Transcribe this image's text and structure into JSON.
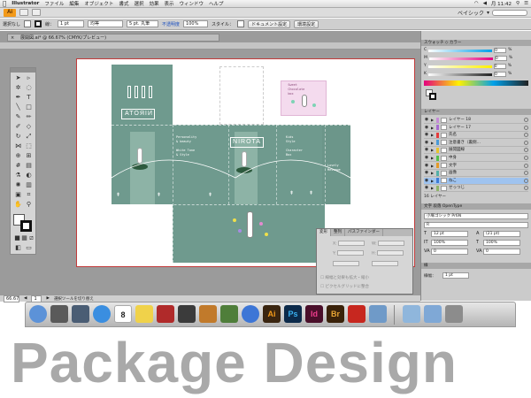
{
  "menubar": {
    "app_name": "Illustrator",
    "items": [
      "ファイル",
      "編集",
      "オブジェクト",
      "書式",
      "選択",
      "効果",
      "表示",
      "ウィンドウ",
      "ヘルプ"
    ],
    "clock": "月 11:42"
  },
  "appbar": {
    "logo": "Ai",
    "workspace": "ベイシック"
  },
  "controlbar": {
    "selection": "選択なし",
    "stroke_weight": "1 pt",
    "stroke_style": "均等",
    "brush": "5 pt. 丸筆",
    "opacity_label": "不透明度",
    "opacity_value": "100%",
    "style_label": "スタイル：",
    "doc_setup_button": "ドキュメント設定",
    "preferences_button": "環境設定"
  },
  "document": {
    "tab_title": "展開図.ai* @ 66.67% (CMYK/プレビュー)"
  },
  "artboard": {
    "brand": "NIROTA",
    "brand_mirrored": "NIROTA",
    "label_text": "   Sweet\n   Chocolate\n   box",
    "info_block": "Personality\n& beauty\n\nWhite Tone\n& Style",
    "right_block": "Kids\nStyle\n\nCharacter\nBox",
    "side_block": "Lovely\nMessage"
  },
  "transform_panel": {
    "tabs": [
      "変形",
      "整列",
      "パスファインダー"
    ],
    "x_label": "X:",
    "y_label": "Y:",
    "w_label": "W:",
    "h_label": "H:",
    "x_value": "0 mm",
    "y_value": "0 mm",
    "w_value": "0 mm",
    "h_value": "0 mm",
    "angle_value": "0°",
    "shear_value": "0°",
    "opt_scale": "線幅と効果も拡大・縮小",
    "opt_grid": "ピクセルグリッドに整合"
  },
  "statusbar": {
    "zoom": "66.67",
    "page": "1",
    "tool_hint": "選択ツールを切り替え"
  },
  "panels": {
    "swatch_tab": "スウォッチ",
    "color_tab": "カラー",
    "color_rows": [
      {
        "label": "C",
        "value": "0",
        "unit": "%",
        "color": "#00a0e9"
      },
      {
        "label": "M",
        "value": "0",
        "unit": "%",
        "color": "#e4007f"
      },
      {
        "label": "Y",
        "value": "0",
        "unit": "%",
        "color": "#fff100"
      },
      {
        "label": "K",
        "value": "0",
        "unit": "%",
        "color": "#222222"
      }
    ],
    "layers_tab": "レイヤー",
    "layers": [
      {
        "name": "レイヤー 18",
        "color": "#c58bd6"
      },
      {
        "name": "レイヤー 17",
        "color": "#a76bd1"
      },
      {
        "name": "氏名",
        "color": "#e43b3b"
      },
      {
        "name": "注意書き（裏側…",
        "color": "#4a9ad8"
      },
      {
        "name": "展開図線",
        "color": "#e8c22c"
      },
      {
        "name": "中身",
        "color": "#54c04c"
      },
      {
        "name": "文字",
        "color": "#e49a2a"
      },
      {
        "name": "画像",
        "color": "#53b0a8"
      },
      {
        "name": "ねこ",
        "color": "#3e7bd6",
        "selected": true
      },
      {
        "name": "せっつじ",
        "color": "#8fb46a"
      }
    ],
    "layers_footer": "16 レイヤー",
    "character_tabs": [
      "文字",
      "段落",
      "OpenType"
    ],
    "font_family": "小塚ゴシック Pr6N",
    "font_style": "R",
    "font_size": "12 pt",
    "leading": "(21 pt)",
    "scale_v": "100%",
    "scale_h": "100%",
    "tracking": "0",
    "kerning": "0",
    "stroke_panel_tab": "線",
    "stroke_label": "線幅：",
    "stroke_value": "1 pt"
  },
  "dock": {
    "apps": [
      {
        "name": "finder",
        "label": "",
        "color": "#5c92d8"
      },
      {
        "name": "launchpad",
        "label": "",
        "color": "#5a5a5a"
      },
      {
        "name": "mission-control",
        "label": "",
        "color": "#4a5d74"
      },
      {
        "name": "safari",
        "label": "",
        "color": "#3a8ee0"
      },
      {
        "name": "calendar",
        "label": "8",
        "color": "#ffffff"
      },
      {
        "name": "stickies",
        "label": "",
        "color": "#f0d24a"
      },
      {
        "name": "photo-booth",
        "label": "",
        "color": "#b02a2a"
      },
      {
        "name": "imovie",
        "label": "",
        "color": "#3b3b3b"
      },
      {
        "name": "garageband",
        "label": "",
        "color": "#c17a2b"
      },
      {
        "name": "iphoto",
        "label": "",
        "color": "#4f7e3a"
      },
      {
        "name": "itunes",
        "label": "",
        "color": "#3d76d6"
      },
      {
        "name": "illustrator",
        "label": "Ai",
        "color": "#3a2510"
      },
      {
        "name": "photoshop",
        "label": "Ps",
        "color": "#0c2a4a"
      },
      {
        "name": "indesign",
        "label": "Id",
        "color": "#4a0f2a"
      },
      {
        "name": "bridge",
        "label": "Br",
        "color": "#3a220a"
      },
      {
        "name": "acrobat",
        "label": "",
        "color": "#c7271f"
      },
      {
        "name": "preview",
        "label": "",
        "color": "#6f9ac8"
      },
      {
        "name": "downloads-folder",
        "label": "",
        "color": "#8fb6dc"
      },
      {
        "name": "documents-folder",
        "label": "",
        "color": "#7fa8d6"
      },
      {
        "name": "trash",
        "label": "",
        "color": "#8c8c8c"
      }
    ]
  },
  "caption": "Package Design"
}
